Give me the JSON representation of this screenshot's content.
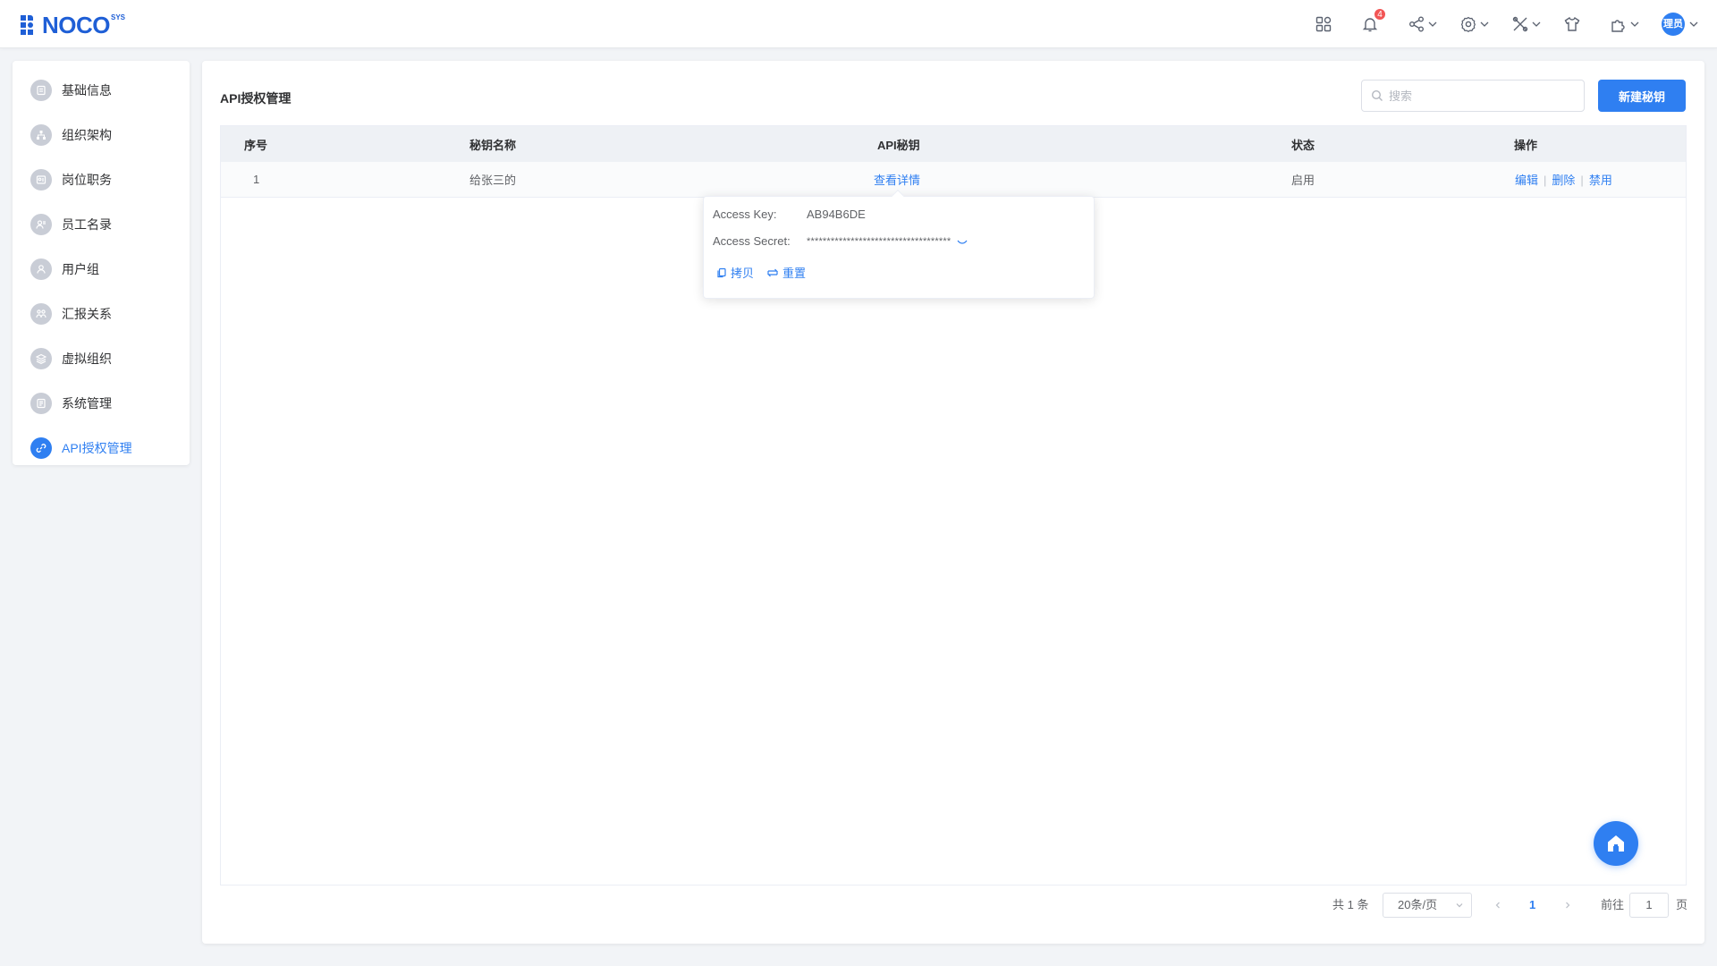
{
  "app": {
    "logo_text": "NOCO",
    "logo_sup": "SYS",
    "notification_count": "4",
    "user_avatar_text": "理员"
  },
  "colors": {
    "primary": "#2f7ff1",
    "logo": "#1f5fd6",
    "badge": "#f25555",
    "icon_inactive": "#c9cdd6"
  },
  "header_icons": [
    "apps-icon",
    "bell-icon",
    "share-icon",
    "gear-icon",
    "tools-icon",
    "shirt-icon",
    "plugin-icon",
    "avatar"
  ],
  "sidebar": {
    "items": [
      {
        "label": "基础信息",
        "icon": "info-doc-icon",
        "active": false
      },
      {
        "label": "组织架构",
        "icon": "org-tree-icon",
        "active": false
      },
      {
        "label": "岗位职务",
        "icon": "position-icon",
        "active": false
      },
      {
        "label": "员工名录",
        "icon": "staff-icon",
        "active": false
      },
      {
        "label": "用户组",
        "icon": "user-group-icon",
        "active": false
      },
      {
        "label": "汇报关系",
        "icon": "report-icon",
        "active": false
      },
      {
        "label": "虚拟组织",
        "icon": "layers-icon",
        "active": false
      },
      {
        "label": "系统管理",
        "icon": "system-icon",
        "active": false
      },
      {
        "label": "API授权管理",
        "icon": "link-icon",
        "active": true
      }
    ]
  },
  "main": {
    "title": "API授权管理",
    "search_placeholder": "搜索",
    "new_button": "新建秘钥",
    "table": {
      "columns": [
        "序号",
        "秘钥名称",
        "API秘钥",
        "状态",
        "操作"
      ],
      "rows": [
        {
          "no": "1",
          "name": "给张三的",
          "key_link": "查看详情",
          "status": "启用",
          "actions": [
            "编辑",
            "删除",
            "禁用"
          ]
        }
      ]
    },
    "popover": {
      "access_key_label": "Access Key:",
      "access_key_value": "AB94B6DE",
      "access_secret_label": "Access Secret:",
      "access_secret_value": "************************************",
      "copy_label": "拷贝",
      "reset_label": "重置"
    },
    "pagination": {
      "total_text": "共 1 条",
      "page_size": "20条/页",
      "current_page": "1",
      "goto_prefix": "前往",
      "goto_value": "1",
      "goto_suffix": "页"
    }
  }
}
